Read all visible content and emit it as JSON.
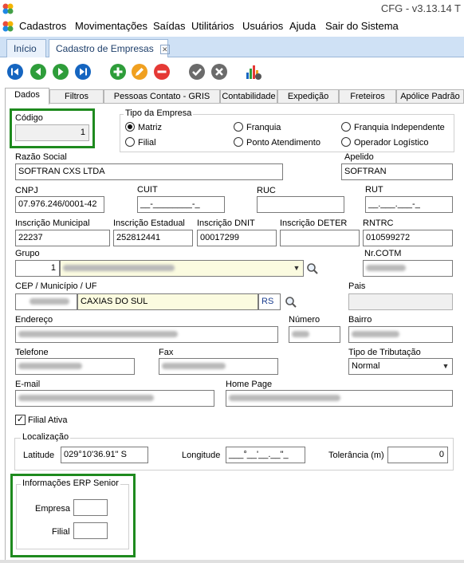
{
  "window": {
    "title": "CFG - v3.13.14  T"
  },
  "menu": {
    "items": [
      "Cadastros",
      "Movimentações",
      "Saídas",
      "Utilitários",
      "Usuários",
      "Ajuda",
      "Sair do Sistema"
    ]
  },
  "doc_tabs": {
    "home": "Início",
    "current": "Cadastro de Empresas"
  },
  "toolbar": {
    "buttons": [
      "first-icon",
      "previous-icon",
      "next-icon",
      "last-icon",
      "add-icon",
      "edit-icon",
      "delete-icon",
      "confirm-icon",
      "cancel-icon",
      "report-icon"
    ]
  },
  "tabs": [
    "Dados",
    "Filtros",
    "Pessoas Contato - GRIS",
    "Contabilidade",
    "Expedição",
    "Freteiros",
    "Apólice Padrão"
  ],
  "form": {
    "codigo": {
      "label": "Código",
      "value": "1"
    },
    "tipo_empresa": {
      "label": "Tipo da Empresa",
      "options": [
        "Matriz",
        "Filial",
        "Franquia",
        "Ponto Atendimento",
        "Franquia Independente",
        "Operador Logístico"
      ],
      "selected": "Matriz"
    },
    "razao_social": {
      "label": "Razão Social",
      "value": "SOFTRAN CXS LTDA"
    },
    "apelido": {
      "label": "Apelido",
      "value": "SOFTRAN"
    },
    "cnpj": {
      "label": "CNPJ",
      "value": "07.976.246/0001-42"
    },
    "cuit": {
      "label": "CUIT",
      "value": "__-________-_"
    },
    "ruc": {
      "label": "RUC",
      "value": ""
    },
    "rut": {
      "label": "RUT",
      "value": "__.___.___-_"
    },
    "inscricao_municipal": {
      "label": "Inscrição Municipal",
      "value": "22237"
    },
    "inscricao_estadual": {
      "label": "Inscrição Estadual",
      "value": "252812441"
    },
    "inscricao_dnit": {
      "label": "Inscrição DNIT",
      "value": "00017299"
    },
    "inscricao_deter": {
      "label": "Inscrição DETER",
      "value": ""
    },
    "rntrc": {
      "label": "RNTRC",
      "value": "010599272"
    },
    "grupo": {
      "label": "Grupo",
      "code": "1"
    },
    "nr_cotm": {
      "label": "Nr.COTM"
    },
    "cep_municipio_uf": {
      "label": "CEP / Município / UF",
      "municipio": "CAXIAS DO SUL",
      "uf": "RS"
    },
    "pais": {
      "label": "Pais",
      "value": ""
    },
    "endereco": {
      "label": "Endereço"
    },
    "numero": {
      "label": "Número"
    },
    "bairro": {
      "label": "Bairro"
    },
    "telefone": {
      "label": "Telefone"
    },
    "fax": {
      "label": "Fax"
    },
    "tipo_tributacao": {
      "label": "Tipo de Tributação",
      "value": "Normal"
    },
    "email": {
      "label": "E-mail"
    },
    "home_page": {
      "label": "Home Page"
    },
    "filial_ativa": {
      "label": "Filial Ativa",
      "checked": true
    },
    "localizacao": {
      "label": "Localização",
      "latitude_label": "Latitude",
      "latitude": "029°10'36.91\" S",
      "longitude_label": "Longitude",
      "longitude": "___°__'__.__\"_",
      "tolerancia_label": "Tolerância (m)",
      "tolerancia": "0"
    },
    "erp_senior": {
      "label": "Informações ERP Senior",
      "empresa_label": "Empresa",
      "empresa": "",
      "filial_label": "Filial",
      "filial": ""
    }
  },
  "colors": {
    "highlight": "#1e8a1e",
    "tab_bar": "#cfe1f5",
    "nav_blue": "#1565c0",
    "add_green": "#2e9d3a",
    "edit_orange": "#f0a020",
    "delete_red": "#e53935"
  }
}
